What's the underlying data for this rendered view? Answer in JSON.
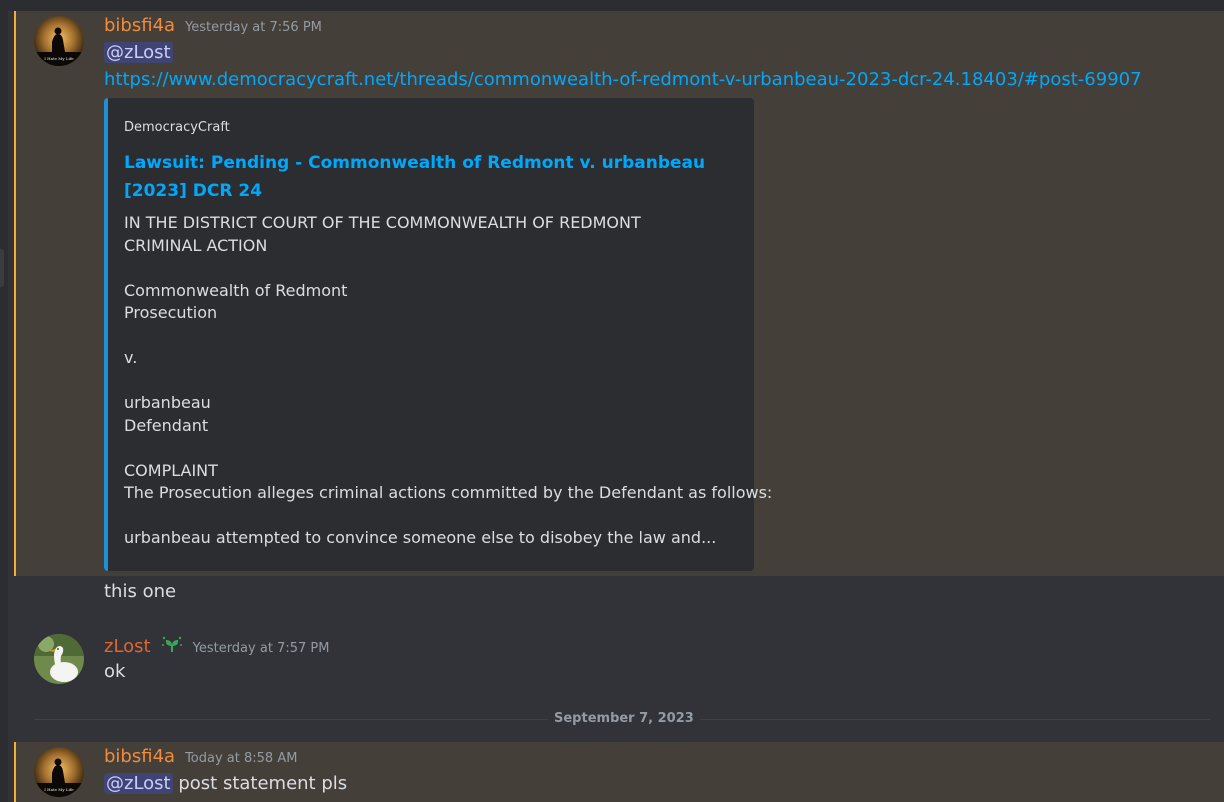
{
  "messages": [
    {
      "username": "bibsfi4a",
      "timestamp": "Yesterday at 7:56 PM",
      "mention": "@zLost",
      "link": "https://www.democracycraft.net/threads/commonwealth-of-redmont-v-urbanbeau-2023-dcr-24.18403/#post-69907",
      "embed": {
        "provider": "DemocracyCraft",
        "title": "Lawsuit: Pending - Commonwealth of Redmont v. urbanbeau [2023] DCR 24",
        "lines": [
          "IN THE DISTRICT COURT OF THE COMMONWEALTH OF REDMONT",
          "CRIMINAL ACTION",
          "Commonwealth of Redmont",
          "Prosecution",
          "v.",
          "urbanbeau",
          "Defendant",
          "COMPLAINT",
          "The Prosecution alleges criminal actions committed by the Defendant as follows:",
          "urbanbeau attempted to convince someone else to disobey the law and..."
        ]
      },
      "followup": "this one"
    },
    {
      "username": "zLost",
      "timestamp": "Yesterday at 7:57 PM",
      "text": "ok"
    },
    {
      "username": "bibsfi4a",
      "timestamp": "Today at 8:58 AM",
      "mention": "@zLost",
      "text": "post statement pls"
    }
  ],
  "date_divider": "September 7, 2023",
  "avatar_caption": "I Hate My Life",
  "colors": {
    "mention_highlight": "#443f39",
    "mention_bar": "#f0b132",
    "link": "#00a8fc",
    "username_bibsfi4a": "#f08c3c",
    "username_zlost": "#e0652e"
  },
  "icons": [
    "avatar-silhouette-icon",
    "avatar-goose-icon",
    "sprout-badge-icon"
  ]
}
